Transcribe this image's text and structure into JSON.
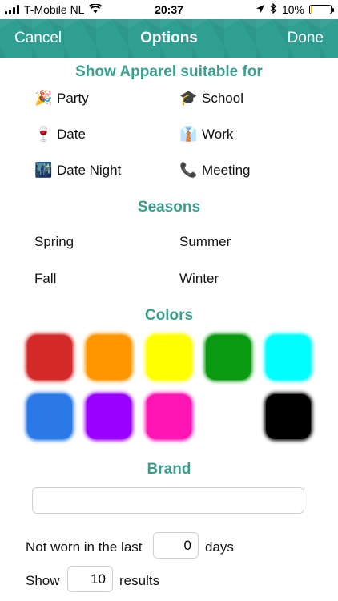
{
  "status": {
    "carrier": "T-Mobile NL",
    "time": "20:37",
    "battery": "10%",
    "battery_level": 0.1
  },
  "nav": {
    "cancel": "Cancel",
    "title": "Options",
    "done": "Done"
  },
  "occasions": {
    "title": "Show Apparel suitable for",
    "items": [
      {
        "label": "Party",
        "icon": "🎉"
      },
      {
        "label": "School",
        "icon": "🎓"
      },
      {
        "label": "Date",
        "icon": "🍷"
      },
      {
        "label": "Work",
        "icon": "👔"
      },
      {
        "label": "Date Night",
        "icon": "🌃"
      },
      {
        "label": "Meeting",
        "icon": "📞"
      }
    ]
  },
  "seasons": {
    "title": "Seasons",
    "items": [
      "Spring",
      "Summer",
      "Fall",
      "Winter"
    ]
  },
  "colors": {
    "title": "Colors",
    "swatches": [
      {
        "name": "red",
        "hex": "#d42a2a"
      },
      {
        "name": "orange",
        "hex": "#ff9600"
      },
      {
        "name": "yellow",
        "hex": "#ffff00"
      },
      {
        "name": "green",
        "hex": "#0a9a12"
      },
      {
        "name": "cyan",
        "hex": "#00ffff"
      },
      {
        "name": "blue",
        "hex": "#2a79e6"
      },
      {
        "name": "purple",
        "hex": "#9a00ff"
      },
      {
        "name": "magenta",
        "hex": "#ff14b4"
      },
      {
        "name": "white",
        "hex": "#ffffff"
      },
      {
        "name": "black",
        "hex": "#000000"
      }
    ]
  },
  "brand": {
    "title": "Brand",
    "value": ""
  },
  "filters": {
    "not_worn_prefix": "Not worn in the last",
    "not_worn_value": "0",
    "not_worn_suffix": "days",
    "show_prefix": "Show",
    "show_value": "10",
    "show_suffix": "results"
  }
}
